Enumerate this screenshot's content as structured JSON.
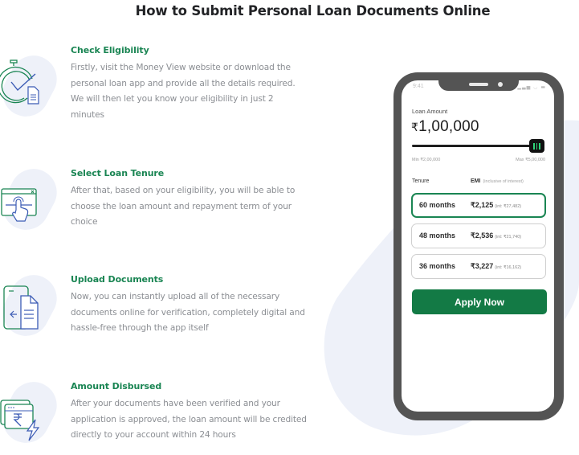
{
  "page": {
    "title": "How to Submit Personal Loan Documents Online"
  },
  "steps": [
    {
      "icon": "stopwatch-document-icon",
      "title": "Check Eligibility",
      "description": "Firstly, visit the Money View website or download the personal loan app and provide all the details required. We will then let you know your eligibility in just 2 minutes"
    },
    {
      "icon": "browser-touch-icon",
      "title": "Select Loan Tenure",
      "description": "After that, based on your eligibility, you will be able to choose the loan amount and repayment term of your choice"
    },
    {
      "icon": "phone-upload-document-icon",
      "title": "Upload Documents",
      "description": "Now, you can instantly upload all of the necessary documents online for verification, completely digital and hassle-free through the app itself"
    },
    {
      "icon": "rupee-lightning-icon",
      "title": "Amount Disbursed",
      "description": "After your documents have been verified and your application is approved, the loan amount will be credited directly to your account within 24 hours"
    }
  ],
  "phone": {
    "status_time": "9:41",
    "status_icons": "signal wifi battery",
    "loan_label": "Loan Amount",
    "loan_currency": "₹",
    "loan_amount": "1,00,000",
    "slider": {
      "min_label": "Min ₹2,00,000",
      "max_label": "Max ₹5,00,000",
      "position_fraction": 1.0
    },
    "table_header": {
      "tenure": "Tenure",
      "emi": "EMI",
      "emi_note": "(inclusive of interest)"
    },
    "tenure_options": [
      {
        "months": "60 months",
        "emi": "₹2,125",
        "interest": "(int: ₹27,482)",
        "selected": true
      },
      {
        "months": "48 months",
        "emi": "₹2,536",
        "interest": "(int: ₹21,740)",
        "selected": false
      },
      {
        "months": "36 months",
        "emi": "₹3,227",
        "interest": "(int: ₹16,162)",
        "selected": false
      }
    ],
    "apply_label": "Apply Now"
  },
  "colors": {
    "brand_green": "#1a8553",
    "button_green": "#137a45",
    "icon_blue": "#3b5bb5",
    "blob": "#eef1f9",
    "phone_frame": "#545454"
  }
}
